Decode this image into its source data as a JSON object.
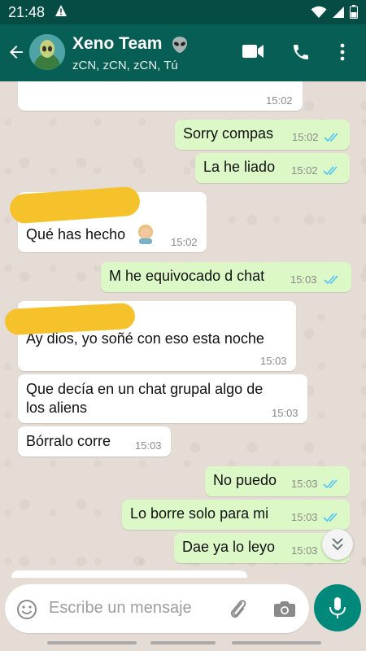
{
  "status_bar": {
    "time": "21:48",
    "warning_icon": "warning-icon"
  },
  "header": {
    "title": "Xeno Team",
    "emoji": "alien-emoji",
    "subtitle": "zCN, zCN, zCN, Tú"
  },
  "messages": [
    {
      "dir": "in",
      "text": "",
      "time": "15:02"
    },
    {
      "dir": "out",
      "text": "Sorry compas",
      "time": "15:02"
    },
    {
      "dir": "out",
      "text": "La he liado",
      "time": "15:02"
    },
    {
      "dir": "in",
      "text": "Qué has hecho",
      "time": "15:02",
      "emoji": "person-emoji"
    },
    {
      "dir": "out",
      "text": "M he equivocado d chat",
      "time": "15:03"
    },
    {
      "dir": "in",
      "text": "Ay dios, yo soñé con eso esta noche",
      "time": "15:03"
    },
    {
      "dir": "in",
      "text_lines": [
        "Que decía en un chat grupal algo de",
        "los aliens"
      ],
      "time": "15:03"
    },
    {
      "dir": "in",
      "text": "Bórralo corre",
      "time": "15:03"
    },
    {
      "dir": "out",
      "text": "No puedo",
      "time": "15:03"
    },
    {
      "dir": "out",
      "text": "Lo borre solo para mi",
      "time": "15:03"
    },
    {
      "dir": "out",
      "text": "Dae ya lo leyo",
      "time": "15:03"
    }
  ],
  "composer": {
    "placeholder": "Escribe un mensaje"
  },
  "colors": {
    "header": "#075e54",
    "status": "#054d44",
    "outgoing": "#dcf8c6",
    "incoming": "#ffffff",
    "accent": "#00897b",
    "tick": "#4fc3f7"
  }
}
